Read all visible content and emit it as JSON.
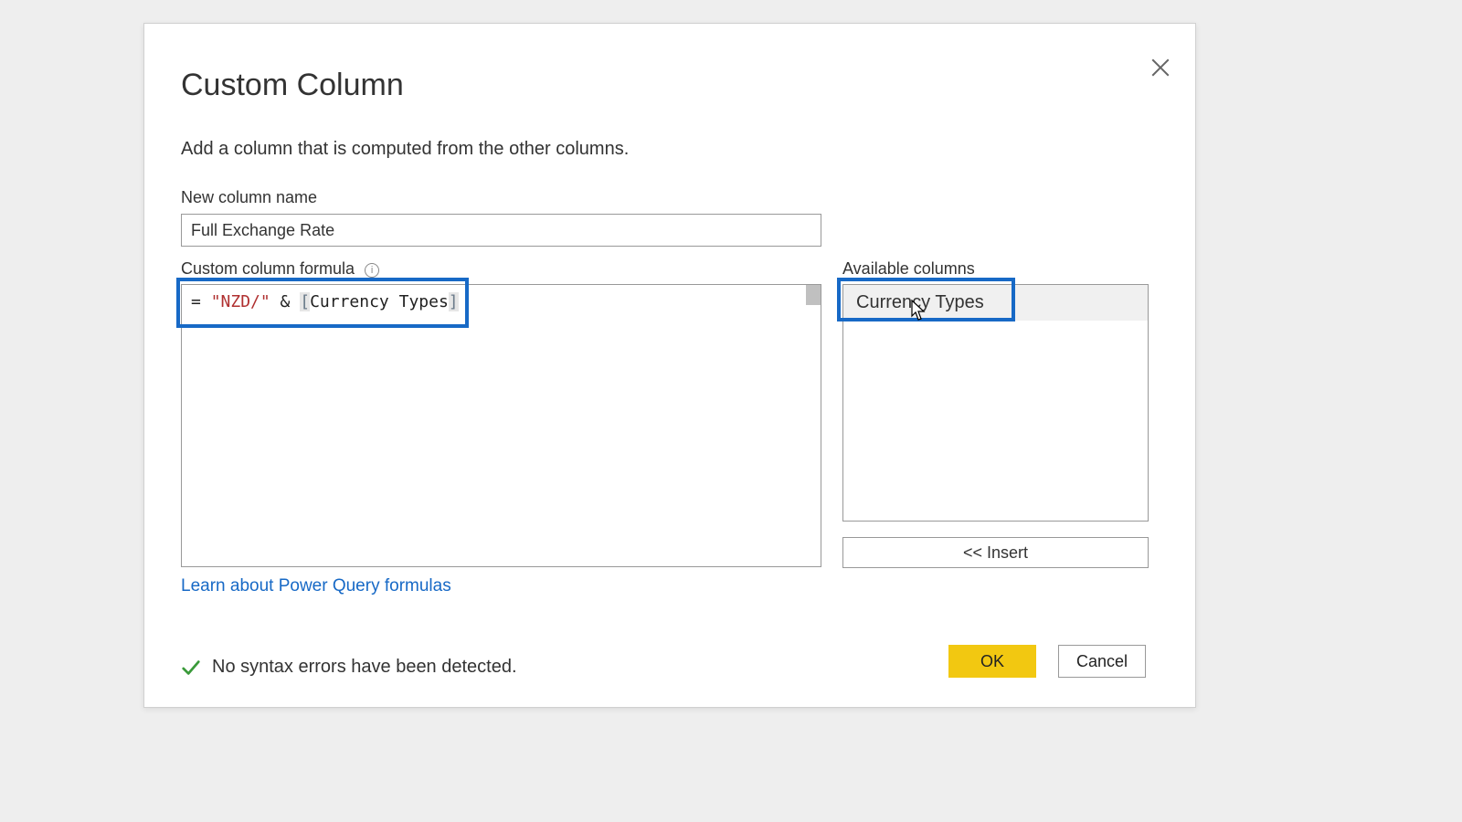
{
  "dialog": {
    "title": "Custom Column",
    "subtitle": "Add a column that is computed from the other columns.",
    "new_column_label": "New column name",
    "new_column_value": "Full Exchange Rate",
    "formula_label": "Custom column formula",
    "formula_tokens": {
      "eq": "= ",
      "str": "\"NZD/\"",
      "amp": " & ",
      "lbr": "[",
      "col": "Currency Types",
      "rbr": "]"
    },
    "available_label": "Available columns",
    "available_items": [
      "Currency Types"
    ],
    "insert_label": "<< Insert",
    "learn_link": "Learn about Power Query formulas",
    "status_text": "No syntax errors have been detected.",
    "ok_label": "OK",
    "cancel_label": "Cancel"
  },
  "highlights": {
    "formula": true,
    "available_item": true
  },
  "colors": {
    "accent": "#f2c811",
    "link": "#1769c6",
    "highlight_border": "#1769c6"
  }
}
